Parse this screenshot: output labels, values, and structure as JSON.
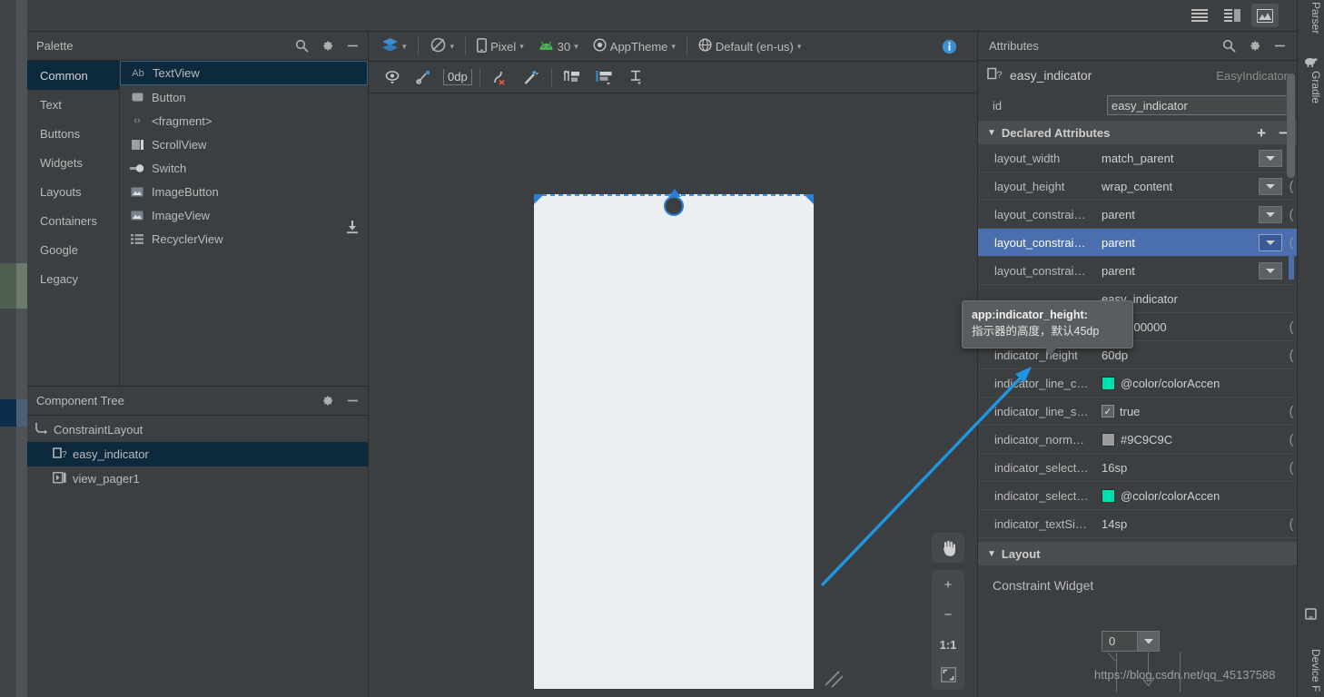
{
  "view_modes": [
    {
      "name": "code-view",
      "label": "Code",
      "active": false
    },
    {
      "name": "split-view",
      "label": "Split",
      "active": false
    },
    {
      "name": "design-view",
      "label": "Design",
      "active": true
    }
  ],
  "palette": {
    "title": "Palette",
    "search_icon": "search-icon",
    "settings_icon": "gear-icon",
    "minimize_icon": "minimize-icon",
    "categories": [
      {
        "label": "Common",
        "selected": true
      },
      {
        "label": "Text",
        "selected": false
      },
      {
        "label": "Buttons",
        "selected": false
      },
      {
        "label": "Widgets",
        "selected": false
      },
      {
        "label": "Layouts",
        "selected": false
      },
      {
        "label": "Containers",
        "selected": false
      },
      {
        "label": "Google",
        "selected": false
      },
      {
        "label": "Legacy",
        "selected": false
      }
    ],
    "items": [
      {
        "label": "TextView",
        "glyph": "Ab",
        "selected": true
      },
      {
        "label": "Button",
        "glyph": "▭",
        "selected": false
      },
      {
        "label": "<fragment>",
        "glyph": "‹›",
        "selected": false
      },
      {
        "label": "ScrollView",
        "glyph": "▧",
        "selected": false
      },
      {
        "label": "Switch",
        "glyph": "⊸",
        "selected": false
      },
      {
        "label": "ImageButton",
        "glyph": "⛰",
        "selected": false
      },
      {
        "label": "ImageView",
        "glyph": "⛰",
        "selected": false
      },
      {
        "label": "RecyclerView",
        "glyph": "☰",
        "selected": false
      }
    ],
    "download_icon": "download-icon"
  },
  "component_tree": {
    "title": "Component Tree",
    "settings_icon": "gear-icon",
    "minimize_icon": "minimize-icon",
    "nodes": [
      {
        "label": "ConstraintLayout",
        "depth": 0,
        "selected": false,
        "icon": "constraint-layout-icon"
      },
      {
        "label": "easy_indicator",
        "depth": 1,
        "selected": true,
        "icon": "unknown-view-icon"
      },
      {
        "label": "view_pager1",
        "depth": 1,
        "selected": false,
        "icon": "viewpager-icon"
      }
    ]
  },
  "editor_toolbar": {
    "design_surface_label": "",
    "device_label": "Pixel",
    "api_label": "30",
    "theme_label": "AppTheme",
    "locale_label": "Default (en-us)",
    "margin_value": "0dp",
    "info_icon": "info-icon",
    "icons": [
      "visibility-icon",
      "no-constraints-icon",
      "clear-constraints-icon",
      "magic-infer-icon",
      "guidelines-icon",
      "align-icon",
      "baseline-icon"
    ]
  },
  "canvas": {
    "zoom_controls": [
      {
        "name": "pan-tool",
        "label": "✋"
      },
      {
        "name": "zoom-in",
        "label": "+"
      },
      {
        "name": "zoom-out",
        "label": "−"
      },
      {
        "name": "zoom-actual",
        "label": "1:1"
      },
      {
        "name": "zoom-fit",
        "label": "⛶"
      }
    ]
  },
  "attributes": {
    "title": "Attributes",
    "search_icon": "search-icon",
    "settings_icon": "gear-icon",
    "minimize_icon": "minimize-icon",
    "component_name": "easy_indicator",
    "component_class": "EasyIndicator",
    "id_label": "id",
    "id_value": "easy_indicator",
    "declared_section": {
      "title": "Declared Attributes",
      "add_label": "+",
      "remove_label": "−"
    },
    "rows": [
      {
        "key": "layout_width",
        "value": "match_parent",
        "type": "dropdown",
        "selected": false
      },
      {
        "key": "layout_height",
        "value": "wrap_content",
        "type": "dropdown",
        "selected": false
      },
      {
        "key": "layout_constrai…",
        "value": "parent",
        "type": "dropdown",
        "selected": false
      },
      {
        "key": "layout_constrai…",
        "value": "parent",
        "type": "dropdown",
        "selected": true
      },
      {
        "key": "layout_constrai…",
        "value": "parent",
        "type": "dropdown",
        "selected": false
      },
      {
        "key": "",
        "value": "easy_indicator",
        "type": "text",
        "selected": false,
        "occluded": true
      },
      {
        "key": "",
        "value": "#000000",
        "type": "color",
        "selected": false,
        "occluded": true,
        "color": "#000000"
      },
      {
        "key": "indicator_height",
        "value": "60dp",
        "type": "text",
        "selected": false
      },
      {
        "key": "indicator_line_c…",
        "value": "@color/colorAccen",
        "type": "color",
        "selected": false,
        "color": "#00dfb0"
      },
      {
        "key": "indicator_line_s…",
        "value": "true",
        "type": "checkbox",
        "selected": false,
        "checked": true
      },
      {
        "key": "indicator_norm…",
        "value": "#9C9C9C",
        "type": "color",
        "selected": false,
        "color": "#9c9c9c"
      },
      {
        "key": "indicator_select…",
        "value": "16sp",
        "type": "text",
        "selected": false
      },
      {
        "key": "indicator_select…",
        "value": "@color/colorAccen",
        "type": "color",
        "selected": false,
        "color": "#00dfb0"
      },
      {
        "key": "indicator_textSi…",
        "value": "14sp",
        "type": "text",
        "selected": false
      }
    ],
    "layout_section": {
      "title": "Layout",
      "constraint_widget_label": "Constraint Widget",
      "spinner_value": "0"
    }
  },
  "tooltip": {
    "line1": "app:indicator_height:",
    "line2": "指示器的高度，默认45dp"
  },
  "right_tabs": [
    {
      "label": "Parser",
      "name": "parser-tab"
    },
    {
      "label": "Gradle",
      "name": "gradle-tab"
    },
    {
      "label": "Device F",
      "name": "device-file-explorer-tab"
    }
  ],
  "watermark": "https://blog.csdn.net/qq_45137588"
}
